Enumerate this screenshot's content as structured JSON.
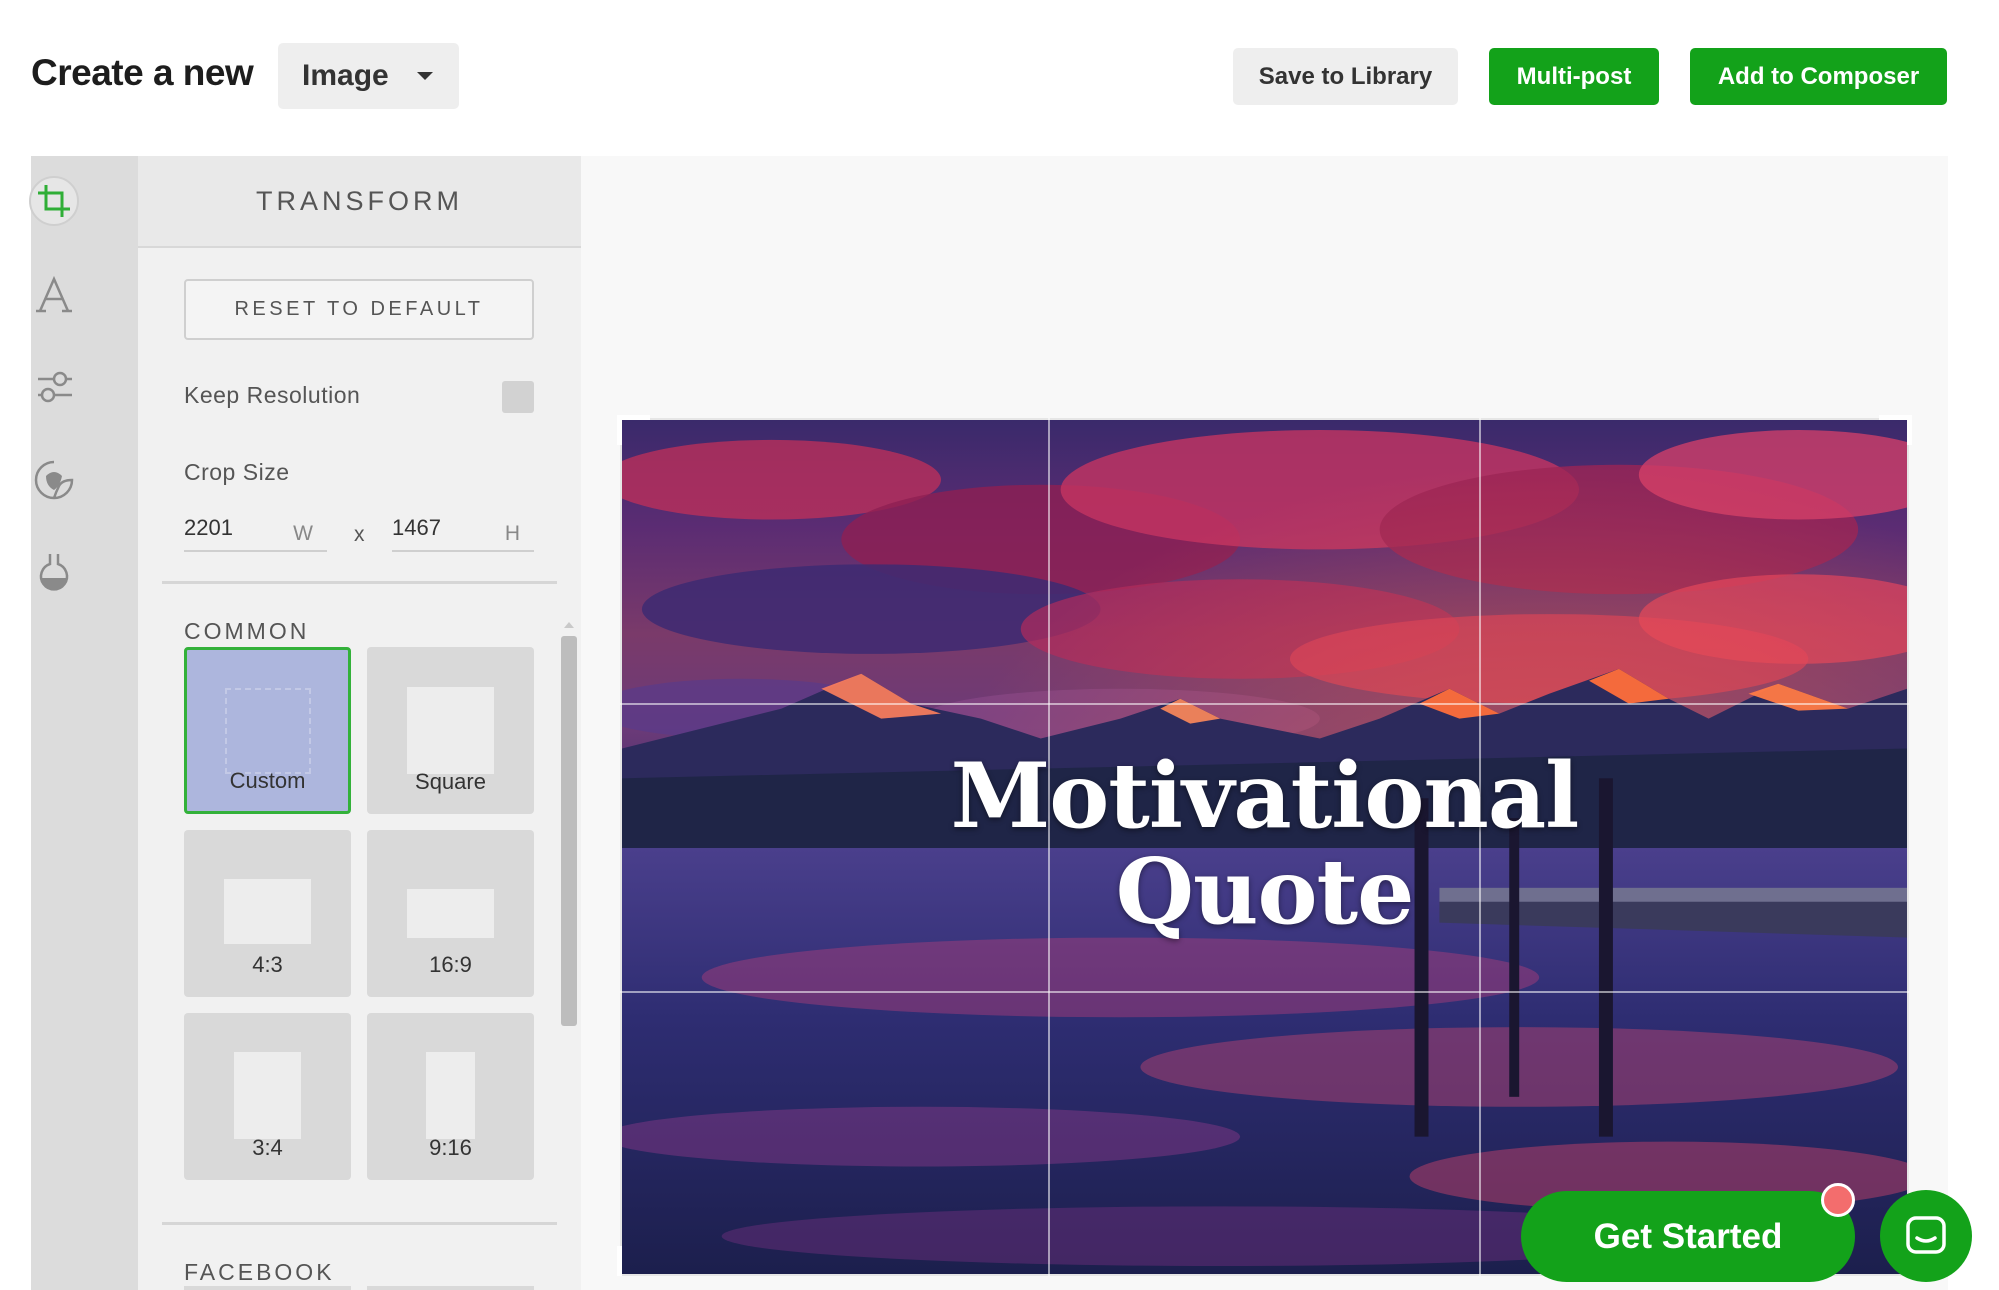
{
  "header": {
    "title": "Create a new",
    "type_select": "Image",
    "save_to_library": "Save to Library",
    "multi_post": "Multi-post",
    "add_to_composer": "Add to Composer"
  },
  "tools": [
    {
      "icon": "crop-icon",
      "active": true
    },
    {
      "icon": "text-icon"
    },
    {
      "icon": "adjust-icon"
    },
    {
      "icon": "sticker-icon"
    },
    {
      "icon": "filter-icon"
    }
  ],
  "panel": {
    "title": "TRANSFORM",
    "reset": "RESET TO DEFAULT",
    "keep_resolution": "Keep Resolution",
    "keep_resolution_checked": false,
    "crop_size_label": "Crop Size",
    "width": "2201",
    "width_unit": "W",
    "times": "x",
    "height": "1467",
    "height_unit": "H",
    "common_label": "COMMON",
    "facebook_label": "FACEBOOK",
    "presets": [
      {
        "label": "Custom",
        "selected": true
      },
      {
        "label": "Square"
      },
      {
        "label": "4:3"
      },
      {
        "label": "16:9"
      },
      {
        "label": "3:4"
      },
      {
        "label": "9:16"
      }
    ]
  },
  "canvas": {
    "quote_line1": "Motivational",
    "quote_line2": "Quote"
  },
  "widgets": {
    "get_started": "Get Started"
  },
  "colors": {
    "accent_green": "#13a21a",
    "selected_preset": "#adb6dd",
    "notification": "#f36d6d"
  }
}
